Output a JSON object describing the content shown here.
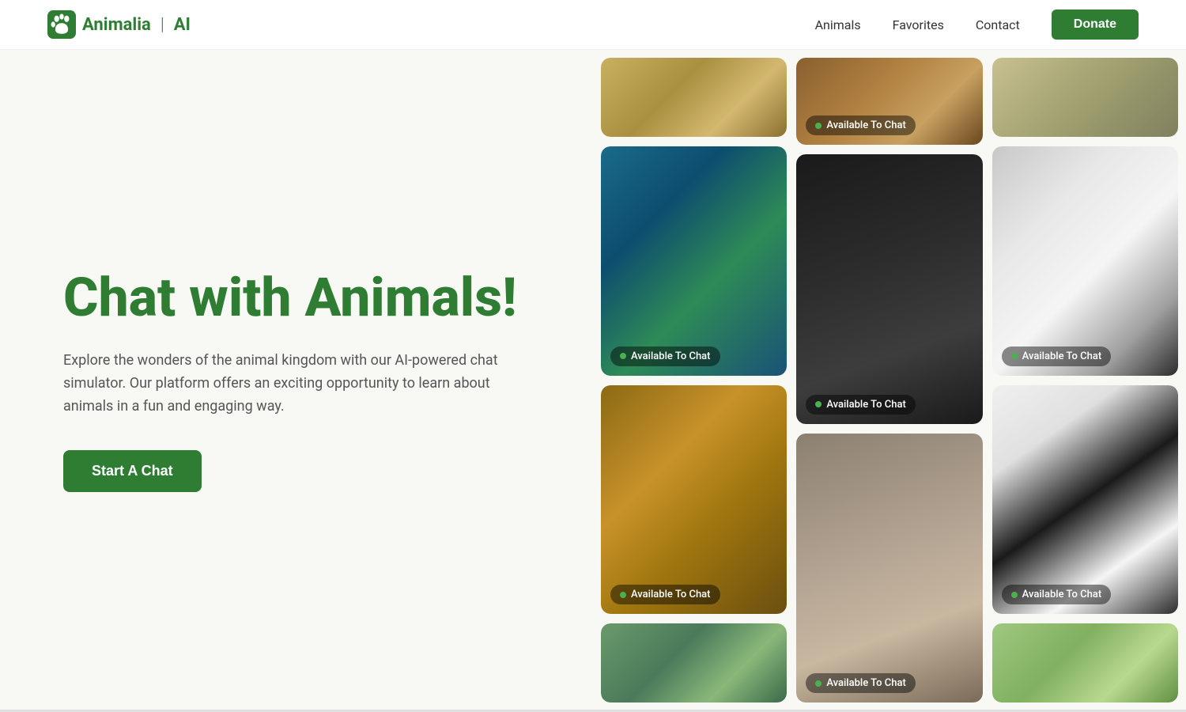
{
  "navbar": {
    "logo_text": "Animalia",
    "logo_divider": "|",
    "logo_ai": "AI",
    "links": [
      {
        "label": "Animals",
        "name": "animals"
      },
      {
        "label": "Favorites",
        "name": "favorites"
      },
      {
        "label": "Contact",
        "name": "contact"
      }
    ],
    "donate_label": "Donate"
  },
  "hero": {
    "title": "Chat with Animals!",
    "description": "Explore the wonders of the animal kingdom with our AI-powered chat simulator. Our platform offers an exciting opportunity to learn about animals in a fun and engaging way.",
    "cta_label": "Start A Chat"
  },
  "available_badge": "Available To Chat",
  "colors": {
    "primary": "#2e7d32",
    "bg": "#f8f9f5"
  }
}
